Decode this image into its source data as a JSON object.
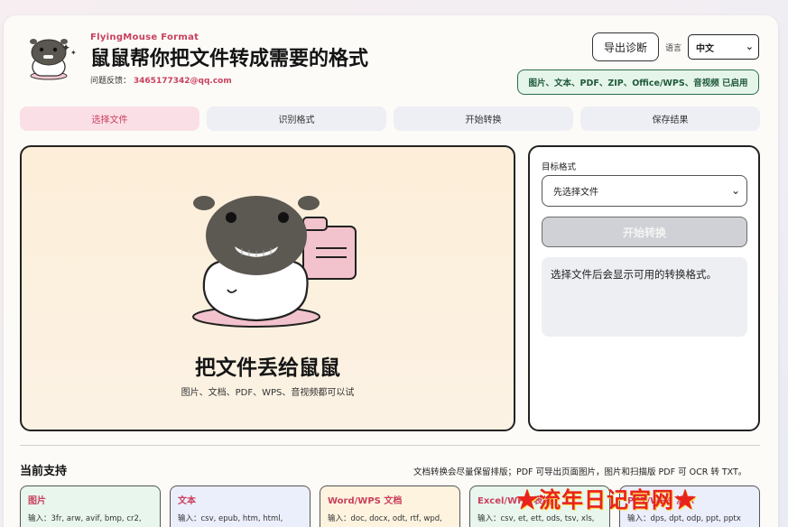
{
  "header": {
    "brand": "FlyingMouse Format",
    "headline": "鼠鼠帮你把文件转成需要的格式",
    "feedback_label": "问题反馈：",
    "feedback_email": "3465177342@qq.com",
    "export_button": "导出诊断",
    "language_label": "语言",
    "language_value": "中文",
    "enabled_badge": "图片、文本、PDF、ZIP、Office/WPS、音视频 已启用"
  },
  "steps": [
    {
      "label": "选择文件",
      "active": true
    },
    {
      "label": "识别格式",
      "active": false
    },
    {
      "label": "开始转换",
      "active": false
    },
    {
      "label": "保存结果",
      "active": false
    }
  ],
  "dropzone": {
    "title": "把文件丢给鼠鼠",
    "subtitle": "图片、文档、PDF、WPS、音视频都可以试"
  },
  "side": {
    "target_label": "目标格式",
    "select_placeholder": "先选择文件",
    "convert_button": "开始转换",
    "hint": "选择文件后会显示可用的转换格式。"
  },
  "support": {
    "title": "当前支持",
    "note": "文档转换会尽量保留排版；PDF 可导出页面图片，图片和扫描版 PDF 可 OCR 转 TXT。",
    "tiles": [
      {
        "name": "图片",
        "inputs": "输入：3fr, arw, avif, bmp, cr2,",
        "color": "#e8f6ee",
        "accent": "#c9405d"
      },
      {
        "name": "文本",
        "inputs": "输入：csv, epub, htm, html,",
        "color": "#ebeefb",
        "accent": "#c9405d"
      },
      {
        "name": "Word/WPS 文档",
        "inputs": "输入：doc, docx, odt, rtf, wpd,",
        "color": "#fdf3df",
        "accent": "#c9405d"
      },
      {
        "name": "Excel/WPS 表格",
        "inputs": "输入：csv, et, ett, ods, tsv, xls,",
        "color": "#e8f6ee",
        "accent": "#c9405d"
      },
      {
        "name": "PPT/WPS 演示",
        "inputs": "输入：dps, dpt, odp, ppt, pptx",
        "color": "#ebeefb",
        "accent": "#c9405d"
      }
    ]
  },
  "watermark": "★流年日记官网★",
  "colors": {
    "accent": "#c9405d",
    "active_step_bg": "#fbdfe6",
    "badge_bg": "#e6f5ea",
    "badge_border": "#2f6b4a",
    "dropzone_bg": "#fdeed9"
  }
}
